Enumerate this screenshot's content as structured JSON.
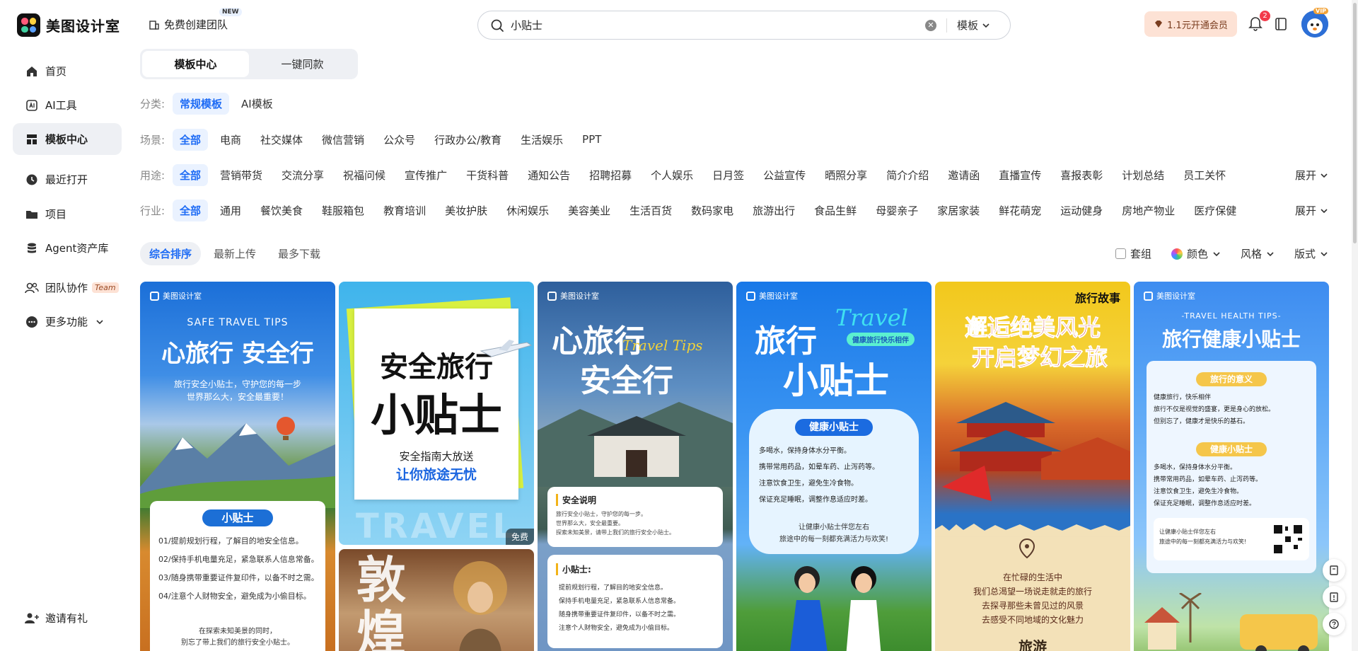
{
  "header": {
    "logo_text": "美图设计室",
    "team_create_label": "免费创建团队",
    "team_create_badge": "NEW",
    "search_value": "小贴士",
    "search_scope": "模板",
    "vip_button": "1.1元开通会员",
    "notification_count": "2",
    "avatar_badge": "VIP"
  },
  "sidebar": {
    "items": [
      {
        "label": "首页",
        "icon": "home-icon"
      },
      {
        "label": "AI工具",
        "icon": "ai-tools-icon"
      },
      {
        "label": "模板中心",
        "icon": "template-icon"
      },
      {
        "label": "最近打开",
        "icon": "clock-icon"
      },
      {
        "label": "项目",
        "icon": "folder-icon"
      },
      {
        "label": "Agent资产库",
        "icon": "database-icon"
      },
      {
        "label": "团队协作",
        "icon": "team-icon",
        "tag": "Team"
      },
      {
        "label": "更多功能",
        "icon": "more-icon"
      }
    ],
    "invite_label": "邀请有礼"
  },
  "tabs": [
    "模板中心",
    "一键同款"
  ],
  "filters": {
    "category": {
      "label": "分类:",
      "options": [
        "常规模板",
        "AI模板"
      ]
    },
    "scene": {
      "label": "场景:",
      "options": [
        "全部",
        "电商",
        "社交媒体",
        "微信营销",
        "公众号",
        "行政办公/教育",
        "生活娱乐",
        "PPT"
      ]
    },
    "usage": {
      "label": "用途:",
      "options": [
        "全部",
        "营销带货",
        "交流分享",
        "祝福问候",
        "宣传推广",
        "干货科普",
        "通知公告",
        "招聘招募",
        "个人娱乐",
        "日月签",
        "公益宣传",
        "晒照分享",
        "简介介绍",
        "邀请函",
        "直播宣传",
        "喜报表彰",
        "计划总结",
        "员工关怀"
      ],
      "expand": "展开"
    },
    "industry": {
      "label": "行业:",
      "options": [
        "全部",
        "通用",
        "餐饮美食",
        "鞋服箱包",
        "教育培训",
        "美妆护肤",
        "休闲娱乐",
        "美容美业",
        "生活百货",
        "数码家电",
        "旅游出行",
        "食品生鲜",
        "母婴亲子",
        "家居家装",
        "鲜花萌宠",
        "运动健身",
        "房地产物业",
        "医疗保健"
      ],
      "expand": "展开"
    }
  },
  "sort": {
    "options": [
      "综合排序",
      "最新上传",
      "最多下载"
    ],
    "set_label": "套组",
    "color_label": "颜色",
    "style_label": "风格",
    "layout_label": "版式"
  },
  "cards": {
    "watermark": "美图设计室",
    "c1": {
      "sub": "SAFE TRAVEL TIPS",
      "title": "心旅行 安全行",
      "desc1": "旅行安全小贴士，守护您的每一步",
      "desc2": "世界那么大，安全最重要！",
      "panel_title": "小贴士",
      "tips": [
        "01/提前规划行程，了解目的地安全信息。",
        "02/保持手机电量充足，紧急联系人信息常备。",
        "03/随身携带重要证件复印件，以备不时之需。",
        "04/注意个人财物安全，避免成为小偷目标。"
      ],
      "foot1": "在探索未知美景的同时，",
      "foot2": "别忘了带上我们的旅行安全小贴士。"
    },
    "c2": {
      "title1": "安全旅行",
      "title2": "小贴士",
      "sub": "安全指南大放送",
      "slogan": "让你旅途无忧",
      "bg_text": "TRAVEL",
      "free": "免费",
      "bottom_text": "敦煌"
    },
    "c3": {
      "title1": "心旅行",
      "title2": "安全行",
      "script": "Travel Tips",
      "p1_title": "安全说明",
      "p1_lines": [
        "旅行安全小贴士，守护您的每一步。",
        "世界那么大，安全最重要。",
        "探索未知美景，请带上我们的旅行安全小贴士。"
      ],
      "p2_title": "小贴士:",
      "p2_lines": [
        "提前规划行程，了解目的地安全信息。",
        "保持手机电量充足，紧急联系人信息常备。",
        "随身携带重要证件复印件，以备不时之需。",
        "注意个人财物安全，避免成为小偷目标。"
      ]
    },
    "c4": {
      "script": "Travel",
      "title1": "旅行",
      "title2": "小贴士",
      "ribbon": "健康旅行快乐相伴",
      "pill": "健康小贴士",
      "tips": [
        "多喝水，保持身体水分平衡。",
        "携带常用药品，如晕车药、止泻药等。",
        "注意饮食卫生，避免生冷食物。",
        "保证充足睡眠，调整作息适应时差。"
      ],
      "foot1": "让健康小贴士伴您左右",
      "foot2": "旅途中的每一刻都充满活力与欢笑!"
    },
    "c5": {
      "tag": "旅行故事",
      "title1": "邂逅绝美风光",
      "title2": "开启梦幻之旅",
      "lines": [
        "在忙碌的生活中",
        "我们总渴望一场说走就走的旅行",
        "去探寻那些未曾见过的风景",
        "去感受不同地域的文化魅力"
      ],
      "bottom": "旅游"
    },
    "c6": {
      "sub": "-TRAVEL HEALTH TIPS-",
      "title": "旅行健康小贴士",
      "pill1": "旅行的意义",
      "list1": [
        "健康旅行，快乐相伴",
        "旅行不仅是视觉的盛宴，更是身心的放松。",
        "但别忘了，健康才是快乐的基石。"
      ],
      "pill2": "健康小贴士",
      "list2": [
        "多喝水，保持身体水分平衡。",
        "携带常用药品，如晕车药、止泻药等。",
        "注意饮食卫生，避免生冷食物。",
        "保证充足睡眠，调整作息适应时差。"
      ],
      "foot1": "让健康小贴士伴您左右",
      "foot2": "旅途中的每一刻都充满活力与欢笑!"
    }
  }
}
